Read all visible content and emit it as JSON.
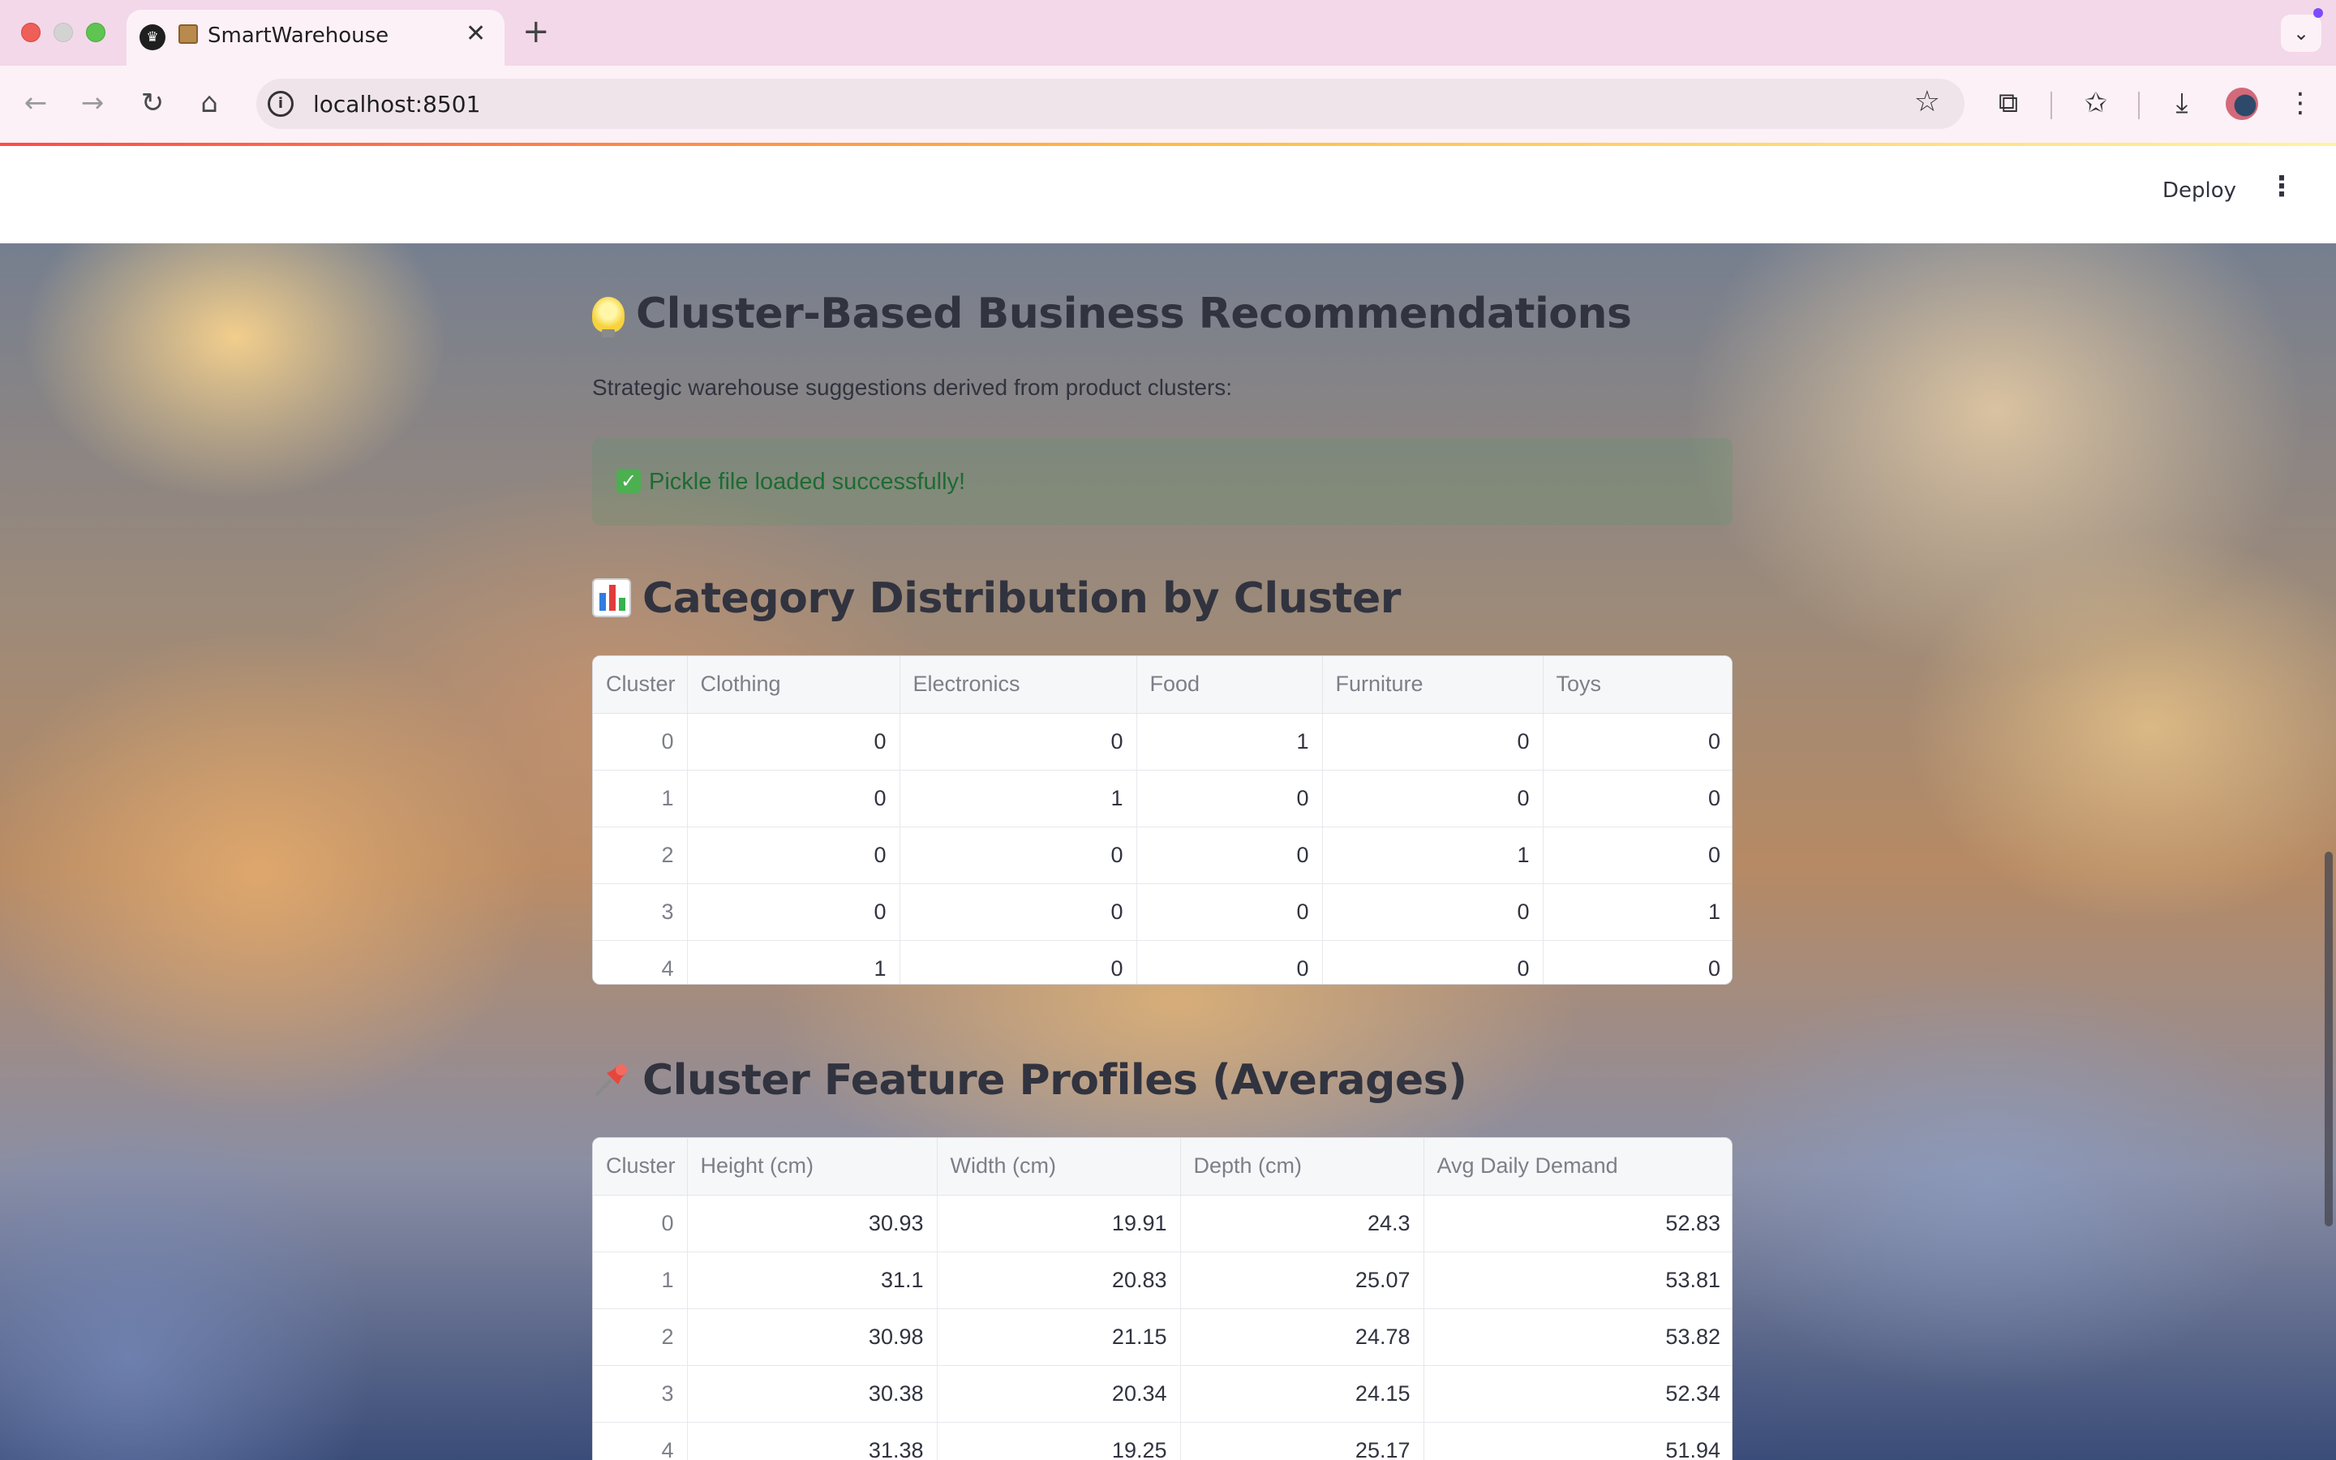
{
  "browser": {
    "tab_title": "SmartWarehouse",
    "tab_close": "✕",
    "new_tab": "+",
    "url": "localhost:8501"
  },
  "header": {
    "deploy_label": "Deploy",
    "menu_icon": "⋮"
  },
  "recommendations": {
    "title": "Cluster-Based Business Recommendations",
    "subtitle": "Strategic warehouse suggestions derived from product clusters:",
    "success_message": "Pickle file loaded successfully!"
  },
  "category_distribution": {
    "title": "Category Distribution by Cluster",
    "columns": [
      "Cluster",
      "Clothing",
      "Electronics",
      "Food",
      "Furniture",
      "Toys"
    ],
    "rows": [
      [
        "0",
        "0",
        "0",
        "1",
        "0",
        "0"
      ],
      [
        "1",
        "0",
        "1",
        "0",
        "0",
        "0"
      ],
      [
        "2",
        "0",
        "0",
        "0",
        "1",
        "0"
      ],
      [
        "3",
        "0",
        "0",
        "0",
        "0",
        "1"
      ],
      [
        "4",
        "1",
        "0",
        "0",
        "0",
        "0"
      ]
    ]
  },
  "feature_profiles": {
    "title": "Cluster Feature Profiles (Averages)",
    "columns": [
      "Cluster",
      "Height (cm)",
      "Width (cm)",
      "Depth (cm)",
      "Avg Daily Demand"
    ],
    "rows": [
      [
        "0",
        "30.93",
        "19.91",
        "24.3",
        "52.83"
      ],
      [
        "1",
        "31.1",
        "20.83",
        "25.07",
        "53.81"
      ],
      [
        "2",
        "30.98",
        "21.15",
        "24.78",
        "53.82"
      ],
      [
        "3",
        "30.38",
        "20.34",
        "24.15",
        "52.34"
      ],
      [
        "4",
        "31.38",
        "19.25",
        "25.17",
        "51.94"
      ]
    ]
  },
  "icons": {
    "favicon": "streamlit-crown-icon",
    "tab_emoji": "package-icon",
    "recommendation_emoji": "light-bulb-icon",
    "distribution_emoji": "bar-chart-icon",
    "profiles_emoji": "pushpin-icon",
    "success_emoji": "check-mark-button-icon"
  },
  "colors": {
    "accent": "#ff4b4b",
    "text": "#31333f",
    "success_text": "#1d6b32"
  }
}
